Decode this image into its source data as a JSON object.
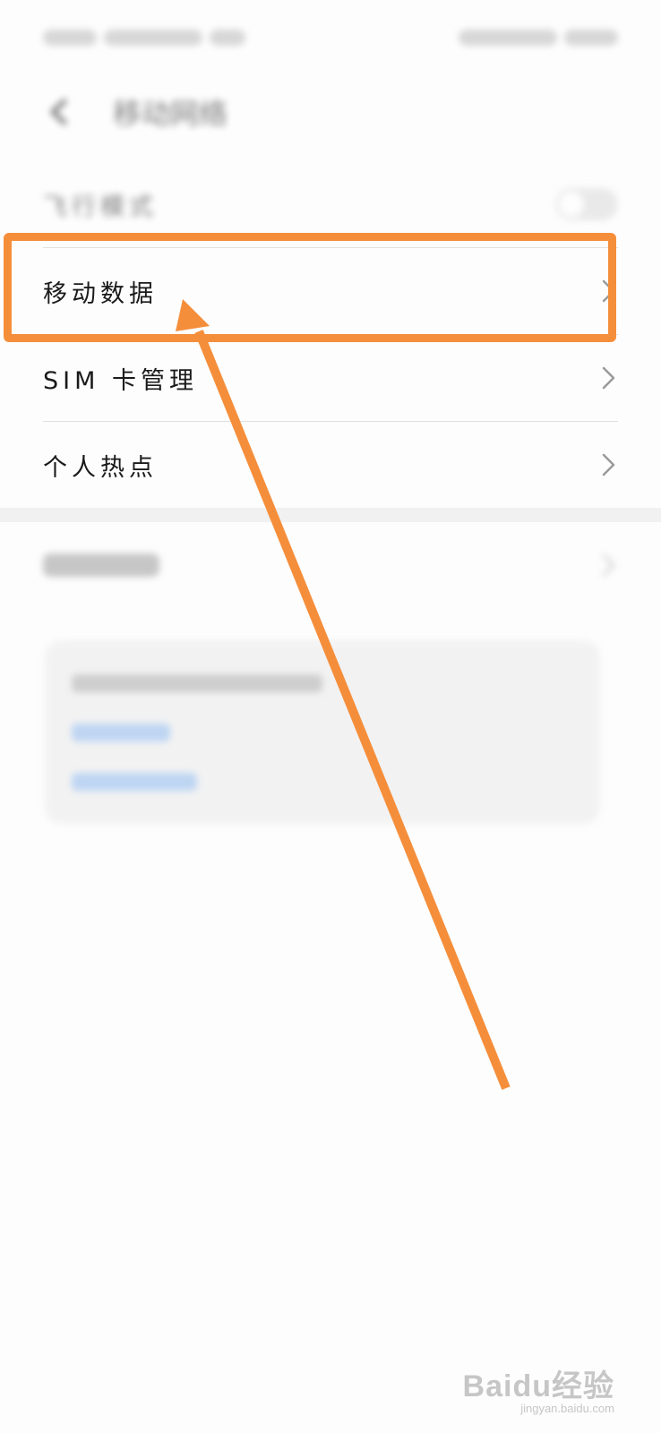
{
  "header": {
    "title": "移动网络"
  },
  "rows": [
    {
      "label": "飞行模式"
    },
    {
      "label": "移动数据"
    },
    {
      "label": "SIM 卡管理"
    },
    {
      "label": "个人热点"
    }
  ],
  "watermark": {
    "logo": "Baidu经验",
    "url": "jingyan.baidu.com"
  },
  "colors": {
    "annotation": "#f58e3b",
    "chevron": "#9a9a9a",
    "divider": "#dedede"
  },
  "icons": {
    "back": "back-arrow-icon",
    "chevron": "chevron-right-icon",
    "annotation_arrow": "arrow-icon"
  }
}
